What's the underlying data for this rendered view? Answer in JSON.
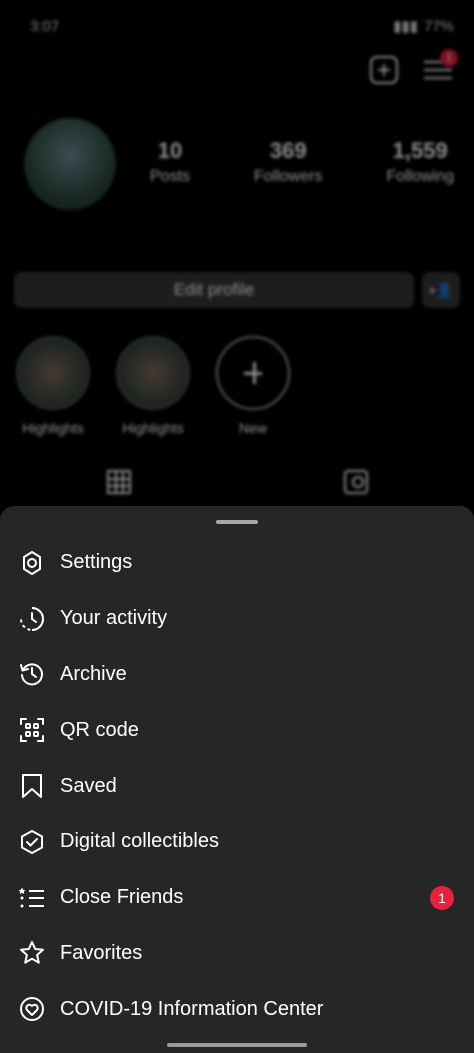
{
  "status": {
    "time": "3:07",
    "battery": "77%"
  },
  "profile": {
    "notif_count": "1",
    "stats": [
      {
        "num": "10",
        "label": "Posts"
      },
      {
        "num": "369",
        "label": "Followers"
      },
      {
        "num": "1,559",
        "label": "Following"
      }
    ],
    "edit_label": "Edit profile",
    "highlights": [
      {
        "label": "Highlights"
      },
      {
        "label": "Highlights"
      },
      {
        "label": "New"
      }
    ]
  },
  "menu": {
    "items": [
      {
        "label": "Settings",
        "icon": "gear-icon"
      },
      {
        "label": "Your activity",
        "icon": "activity-icon"
      },
      {
        "label": "Archive",
        "icon": "archive-icon"
      },
      {
        "label": "QR code",
        "icon": "qr-code-icon"
      },
      {
        "label": "Saved",
        "icon": "bookmark-icon"
      },
      {
        "label": "Digital collectibles",
        "icon": "shield-check-icon"
      },
      {
        "label": "Close Friends",
        "icon": "list-stars-icon",
        "badge": "1"
      },
      {
        "label": "Favorites",
        "icon": "star-icon"
      },
      {
        "label": "COVID-19 Information Center",
        "icon": "heart-circle-icon"
      }
    ]
  }
}
